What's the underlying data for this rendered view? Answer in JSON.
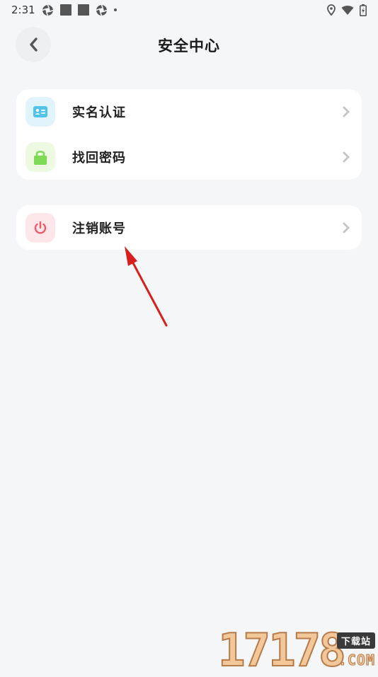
{
  "status_bar": {
    "time": "2:31"
  },
  "header": {
    "title": "安全中心"
  },
  "menu": {
    "items": [
      {
        "label": "实名认证",
        "icon": "id-card-icon",
        "icon_bg": "#e2f4fb",
        "icon_color": "#4fc3e8"
      },
      {
        "label": "找回密码",
        "icon": "lock-icon",
        "icon_bg": "#eef9e2",
        "icon_color": "#7ed957"
      },
      {
        "label": "注销账号",
        "icon": "power-icon",
        "icon_bg": "#fde7ea",
        "icon_color": "#f05a67"
      }
    ]
  },
  "watermark": {
    "number": "17178",
    "tag": "下载站",
    "domain": ".COM"
  },
  "colors": {
    "background": "#f5f6f8",
    "card": "#ffffff",
    "annotation_arrow": "#d91e1e",
    "chevron": "#c4c6ca"
  }
}
